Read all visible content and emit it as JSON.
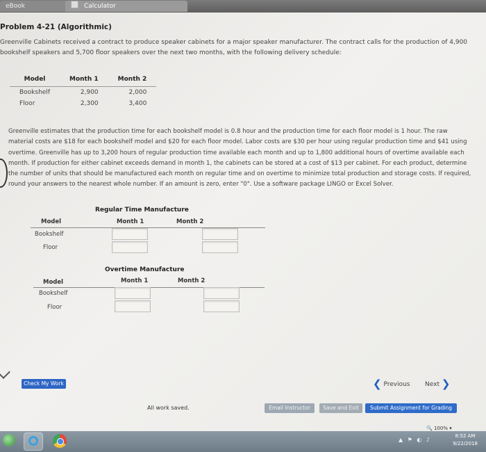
{
  "tabs": {
    "ebook": "eBook",
    "calculator": "Calculator"
  },
  "problem": {
    "title": "Problem 4-21 (Algorithmic)",
    "intro": "Greenville Cabinets received a contract to produce speaker cabinets for a major speaker manufacturer. The contract calls for the production of 4,900 bookshelf speakers and 5,700 floor speakers over the next two months, with the following delivery schedule:",
    "body": "Greenville estimates that the production time for each bookshelf model is 0.8 hour and the production time for each floor model is 1 hour. The raw material costs are $18 for each bookshelf model and $20 for each floor model. Labor costs are $30 per hour using regular production time and $41 using overtime. Greenville has up to 3,200 hours of regular production time available each month and up to 1,800 additional hours of overtime available each month. If production for either cabinet exceeds demand in month 1, the cabinets can be stored at a cost of $13 per cabinet. For each product, determine the number of units that should be manufactured each month on regular time and on overtime to minimize total production and storage costs. If required, round your answers to the nearest whole number. If an amount is zero, enter \"0\". Use a software package LINGO or Excel Solver."
  },
  "delivery_table": {
    "headers": [
      "Model",
      "Month 1",
      "Month 2"
    ],
    "rows": [
      [
        "Bookshelf",
        "2,900",
        "2,000"
      ],
      [
        "Floor",
        "2,300",
        "3,400"
      ]
    ]
  },
  "regular": {
    "heading": "Regular Time Manufacture",
    "model": "Model",
    "month1": "Month 1",
    "month2": "Month 2",
    "rows": [
      "Bookshelf",
      "Floor"
    ]
  },
  "overtime": {
    "heading": "Overtime Manufacture",
    "model": "Model",
    "month1": "Month 1",
    "month2": "Month 2",
    "rows": [
      "Bookshelf",
      "Floor"
    ]
  },
  "buttons": {
    "check": "Check My Work",
    "previous": "Previous",
    "next": "Next",
    "email": "Email Instructor",
    "save_exit": "Save and Exit",
    "submit": "Submit Assignment for Grading"
  },
  "status": {
    "saved": "All work saved."
  },
  "taskbar": {
    "zoom": "100%",
    "time": "8:52 AM",
    "date": "9/22/2018"
  }
}
